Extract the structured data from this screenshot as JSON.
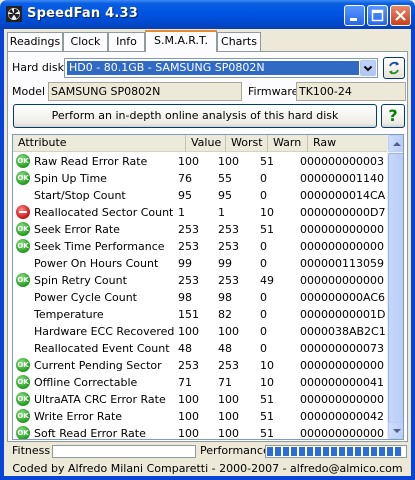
{
  "window": {
    "title": "SpeedFan 4.33"
  },
  "tabs": [
    {
      "label": "Readings"
    },
    {
      "label": "Clock"
    },
    {
      "label": "Info"
    },
    {
      "label": "S.M.A.R.T."
    },
    {
      "label": "Charts"
    }
  ],
  "active_tab": "S.M.A.R.T.",
  "disk": {
    "label": "Hard disk",
    "selected": "HD0 - 80.1GB - SAMSUNG SP0802N",
    "model_label": "Model",
    "model": "SAMSUNG SP0802N",
    "firmware_label": "Firmware",
    "firmware": "TK100-24"
  },
  "analysis_button": "Perform an in-depth online analysis of this hard disk",
  "help_button": "?",
  "table": {
    "headers": [
      "Attribute",
      "Value",
      "Worst",
      "Warn",
      "Raw"
    ],
    "rows": [
      {
        "status": "ok",
        "attribute": "Raw Read Error Rate",
        "value": "100",
        "worst": "100",
        "warn": "51",
        "raw": "000000000003"
      },
      {
        "status": "ok",
        "attribute": "Spin Up Time",
        "value": "76",
        "worst": "55",
        "warn": "0",
        "raw": "000000001140"
      },
      {
        "status": "none",
        "attribute": "Start/Stop Count",
        "value": "95",
        "worst": "95",
        "warn": "0",
        "raw": "0000000014CA"
      },
      {
        "status": "bad",
        "attribute": "Reallocated Sector Count",
        "value": "1",
        "worst": "1",
        "warn": "10",
        "raw": "0000000000D7"
      },
      {
        "status": "ok",
        "attribute": "Seek Error Rate",
        "value": "253",
        "worst": "253",
        "warn": "51",
        "raw": "000000000000"
      },
      {
        "status": "ok",
        "attribute": "Seek Time Performance",
        "value": "253",
        "worst": "253",
        "warn": "0",
        "raw": "000000000000"
      },
      {
        "status": "none",
        "attribute": "Power On Hours Count",
        "value": "99",
        "worst": "99",
        "warn": "0",
        "raw": "000000113059"
      },
      {
        "status": "ok",
        "attribute": "Spin Retry Count",
        "value": "253",
        "worst": "253",
        "warn": "49",
        "raw": "000000000000"
      },
      {
        "status": "none",
        "attribute": "Power Cycle Count",
        "value": "98",
        "worst": "98",
        "warn": "0",
        "raw": "000000000AC6"
      },
      {
        "status": "none",
        "attribute": "Temperature",
        "value": "151",
        "worst": "82",
        "warn": "0",
        "raw": "00000000001D"
      },
      {
        "status": "none",
        "attribute": "Hardware ECC Recovered",
        "value": "100",
        "worst": "100",
        "warn": "0",
        "raw": "0000038AB2C1"
      },
      {
        "status": "none",
        "attribute": "Reallocated Event Count",
        "value": "48",
        "worst": "48",
        "warn": "0",
        "raw": "000000000073"
      },
      {
        "status": "ok",
        "attribute": "Current Pending Sector",
        "value": "253",
        "worst": "253",
        "warn": "10",
        "raw": "000000000000"
      },
      {
        "status": "ok",
        "attribute": "Offline Correctable",
        "value": "71",
        "worst": "71",
        "warn": "10",
        "raw": "000000000041"
      },
      {
        "status": "ok",
        "attribute": "UltraATA CRC Error Rate",
        "value": "100",
        "worst": "100",
        "warn": "51",
        "raw": "000000000000"
      },
      {
        "status": "ok",
        "attribute": "Write Error Rate",
        "value": "100",
        "worst": "100",
        "warn": "51",
        "raw": "000000000042"
      },
      {
        "status": "ok",
        "attribute": "Soft Read Error Rate",
        "value": "100",
        "worst": "100",
        "warn": "51",
        "raw": "000000000000"
      }
    ]
  },
  "status_icon_text": "OK",
  "fitness_label": "Fitness",
  "fitness_level": 0,
  "performance_label": "Performance",
  "performance_level": 0.98,
  "footer": "Coded by Alfredo Milani Comparetti - 2000-2007 - alfredo@almico.com",
  "colors": {
    "title_bar": "#0054e3",
    "selection": "#316ac5",
    "ok_icon": "#1f9a1a",
    "bad_icon": "#c81010",
    "active_tab_accent": "#e68b2c",
    "performance_bar": "#2d6bd6"
  }
}
